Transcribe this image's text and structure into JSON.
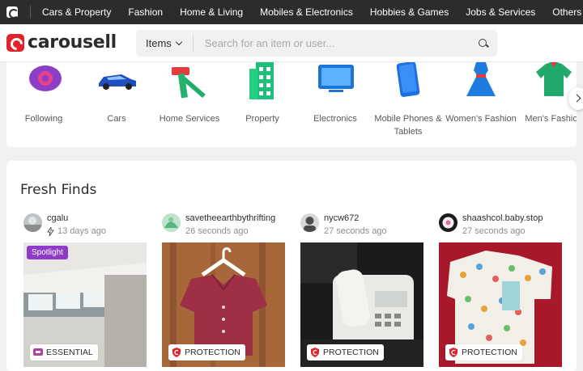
{
  "topnav": {
    "items": [
      "Cars & Property",
      "Fashion",
      "Home & Living",
      "Mobiles & Electronics",
      "Hobbies & Games",
      "Jobs & Services",
      "Others"
    ]
  },
  "header": {
    "logo_text": "carousell",
    "search": {
      "scope": "Items",
      "placeholder": "Search for an item or user..."
    }
  },
  "categories": [
    {
      "label": "Following",
      "icon": "eye-icon"
    },
    {
      "label": "Cars",
      "icon": "car-icon"
    },
    {
      "label": "Home Services",
      "icon": "hammer-icon"
    },
    {
      "label": "Property",
      "icon": "building-icon"
    },
    {
      "label": "Electronics",
      "icon": "tv-icon"
    },
    {
      "label": "Mobile Phones & Tablets",
      "icon": "phone-icon"
    },
    {
      "label": "Women's Fashion",
      "icon": "dress-icon"
    },
    {
      "label": "Men's Fashion",
      "icon": "shirt-icon"
    }
  ],
  "fresh": {
    "title": "Fresh Finds",
    "listings": [
      {
        "username": "cgalu",
        "time": "13 days ago",
        "bumped": true,
        "spotlight": "Spotlight",
        "badge": "ESSENTIAL"
      },
      {
        "username": "savetheearthbythrifting",
        "time": "26 seconds ago",
        "bumped": false,
        "badge": "PROTECTION"
      },
      {
        "username": "nycw672",
        "time": "27 seconds ago",
        "bumped": false,
        "badge": "PROTECTION"
      },
      {
        "username": "shaashcol.baby.stop",
        "time": "27 seconds ago",
        "bumped": false,
        "badge": "PROTECTION"
      }
    ]
  },
  "colors": {
    "brand": "#e0242b",
    "topnav_bg": "#2c2c2d",
    "spotlight": "#8e3bc8"
  }
}
